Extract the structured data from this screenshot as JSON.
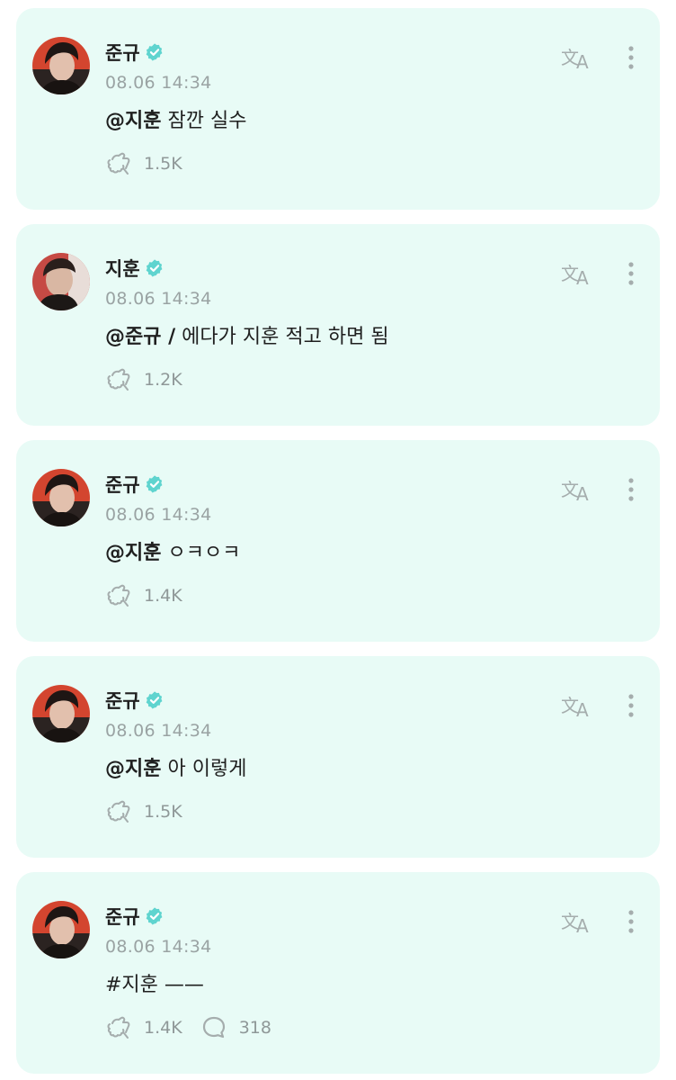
{
  "colors": {
    "card_bg": "#e8fbf6",
    "verified": "#5fd4cf",
    "meta_text": "#9aa3a3",
    "icon": "#a5adad"
  },
  "posts": [
    {
      "author": "준규",
      "avatar": "junkyu-avatar",
      "timestamp": "08.06 14:34",
      "mention": "@지훈",
      "text": " 잠깐 실수",
      "likes": "1.5K",
      "comments": null
    },
    {
      "author": "지훈",
      "avatar": "jihoon-avatar",
      "timestamp": "08.06 14:34",
      "mention": "@준규 /",
      "text": " 에다가 지훈 적고 하면 됨",
      "likes": "1.2K",
      "comments": null
    },
    {
      "author": "준규",
      "avatar": "junkyu-avatar",
      "timestamp": "08.06 14:34",
      "mention": "@지훈",
      "text": " ㅇㅋㅇㅋ",
      "likes": "1.4K",
      "comments": null
    },
    {
      "author": "준규",
      "avatar": "junkyu-avatar",
      "timestamp": "08.06 14:34",
      "mention": "@지훈",
      "text": " 아 이렇게",
      "likes": "1.5K",
      "comments": null
    },
    {
      "author": "준규",
      "avatar": "junkyu-avatar",
      "timestamp": "08.06 14:34",
      "mention": "",
      "text": "#지훈 ——",
      "likes": "1.4K",
      "comments": "318"
    }
  ],
  "icons": {
    "translate": "translate-icon",
    "more": "more-vertical-icon",
    "like": "like-icon",
    "comment": "comment-icon",
    "verified": "verified-badge-icon"
  }
}
